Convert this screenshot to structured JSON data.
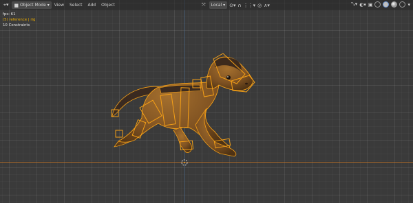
{
  "header": {
    "mode_label": "Object Mode",
    "menus": [
      "View",
      "Select",
      "Add",
      "Object"
    ],
    "transform_orientation": "Local",
    "pivot_icon": "pivot-icon",
    "snap_icon": "magnet-icon",
    "proportional_icon": "proportional-edit-icon",
    "shading_modes": [
      "wireframe",
      "solid",
      "material-preview",
      "rendered"
    ],
    "active_shading": "solid"
  },
  "overlay": {
    "fps": "fps: 61",
    "reference": "(5) reference | rig",
    "selection_count": "10 Constraints"
  },
  "colors": {
    "background": "#3a3a3a",
    "selection_outline": "#f5a017",
    "active_outline": "#ffd07a",
    "x_axis": "#c07226",
    "reference_text": "#f0b000",
    "model_body": "#8a5a25",
    "model_dark": "#3d2a1c"
  }
}
